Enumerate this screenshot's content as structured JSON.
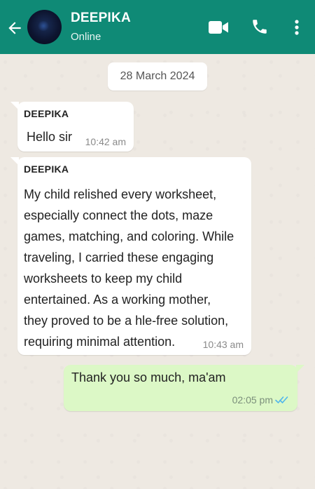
{
  "header": {
    "contact_name": "DEEPIKA",
    "status": "Online",
    "icons": [
      "back-arrow-icon",
      "video-call-icon",
      "phone-icon",
      "more-vertical-icon"
    ]
  },
  "date_chip": "28 March 2024",
  "messages": [
    {
      "direction": "incoming",
      "sender": "DEEPIKA",
      "text": "Hello sir",
      "time": "10:42 am"
    },
    {
      "direction": "incoming",
      "sender": "DEEPIKA",
      "text": " My child relished every worksheet,\nespecially connect the dots, maze\ngames, matching, and coloring. While\ntraveling, I carried these engaging\nworksheets to keep my child\nentertained. As a working mother,\nthey proved to be a hle-free solution,\nrequiring minimal attention.",
      "time": "10:43 am"
    },
    {
      "direction": "outgoing",
      "text": "Thank you so much, ma'am",
      "time": "02:05 pm",
      "status_icon": "read-double-tick-icon"
    }
  ],
  "colors": {
    "header": "#0f8a76",
    "incoming_bubble": "#ffffff",
    "outgoing_bubble": "#dcf8c6",
    "read_tick": "#4fb6ec"
  }
}
